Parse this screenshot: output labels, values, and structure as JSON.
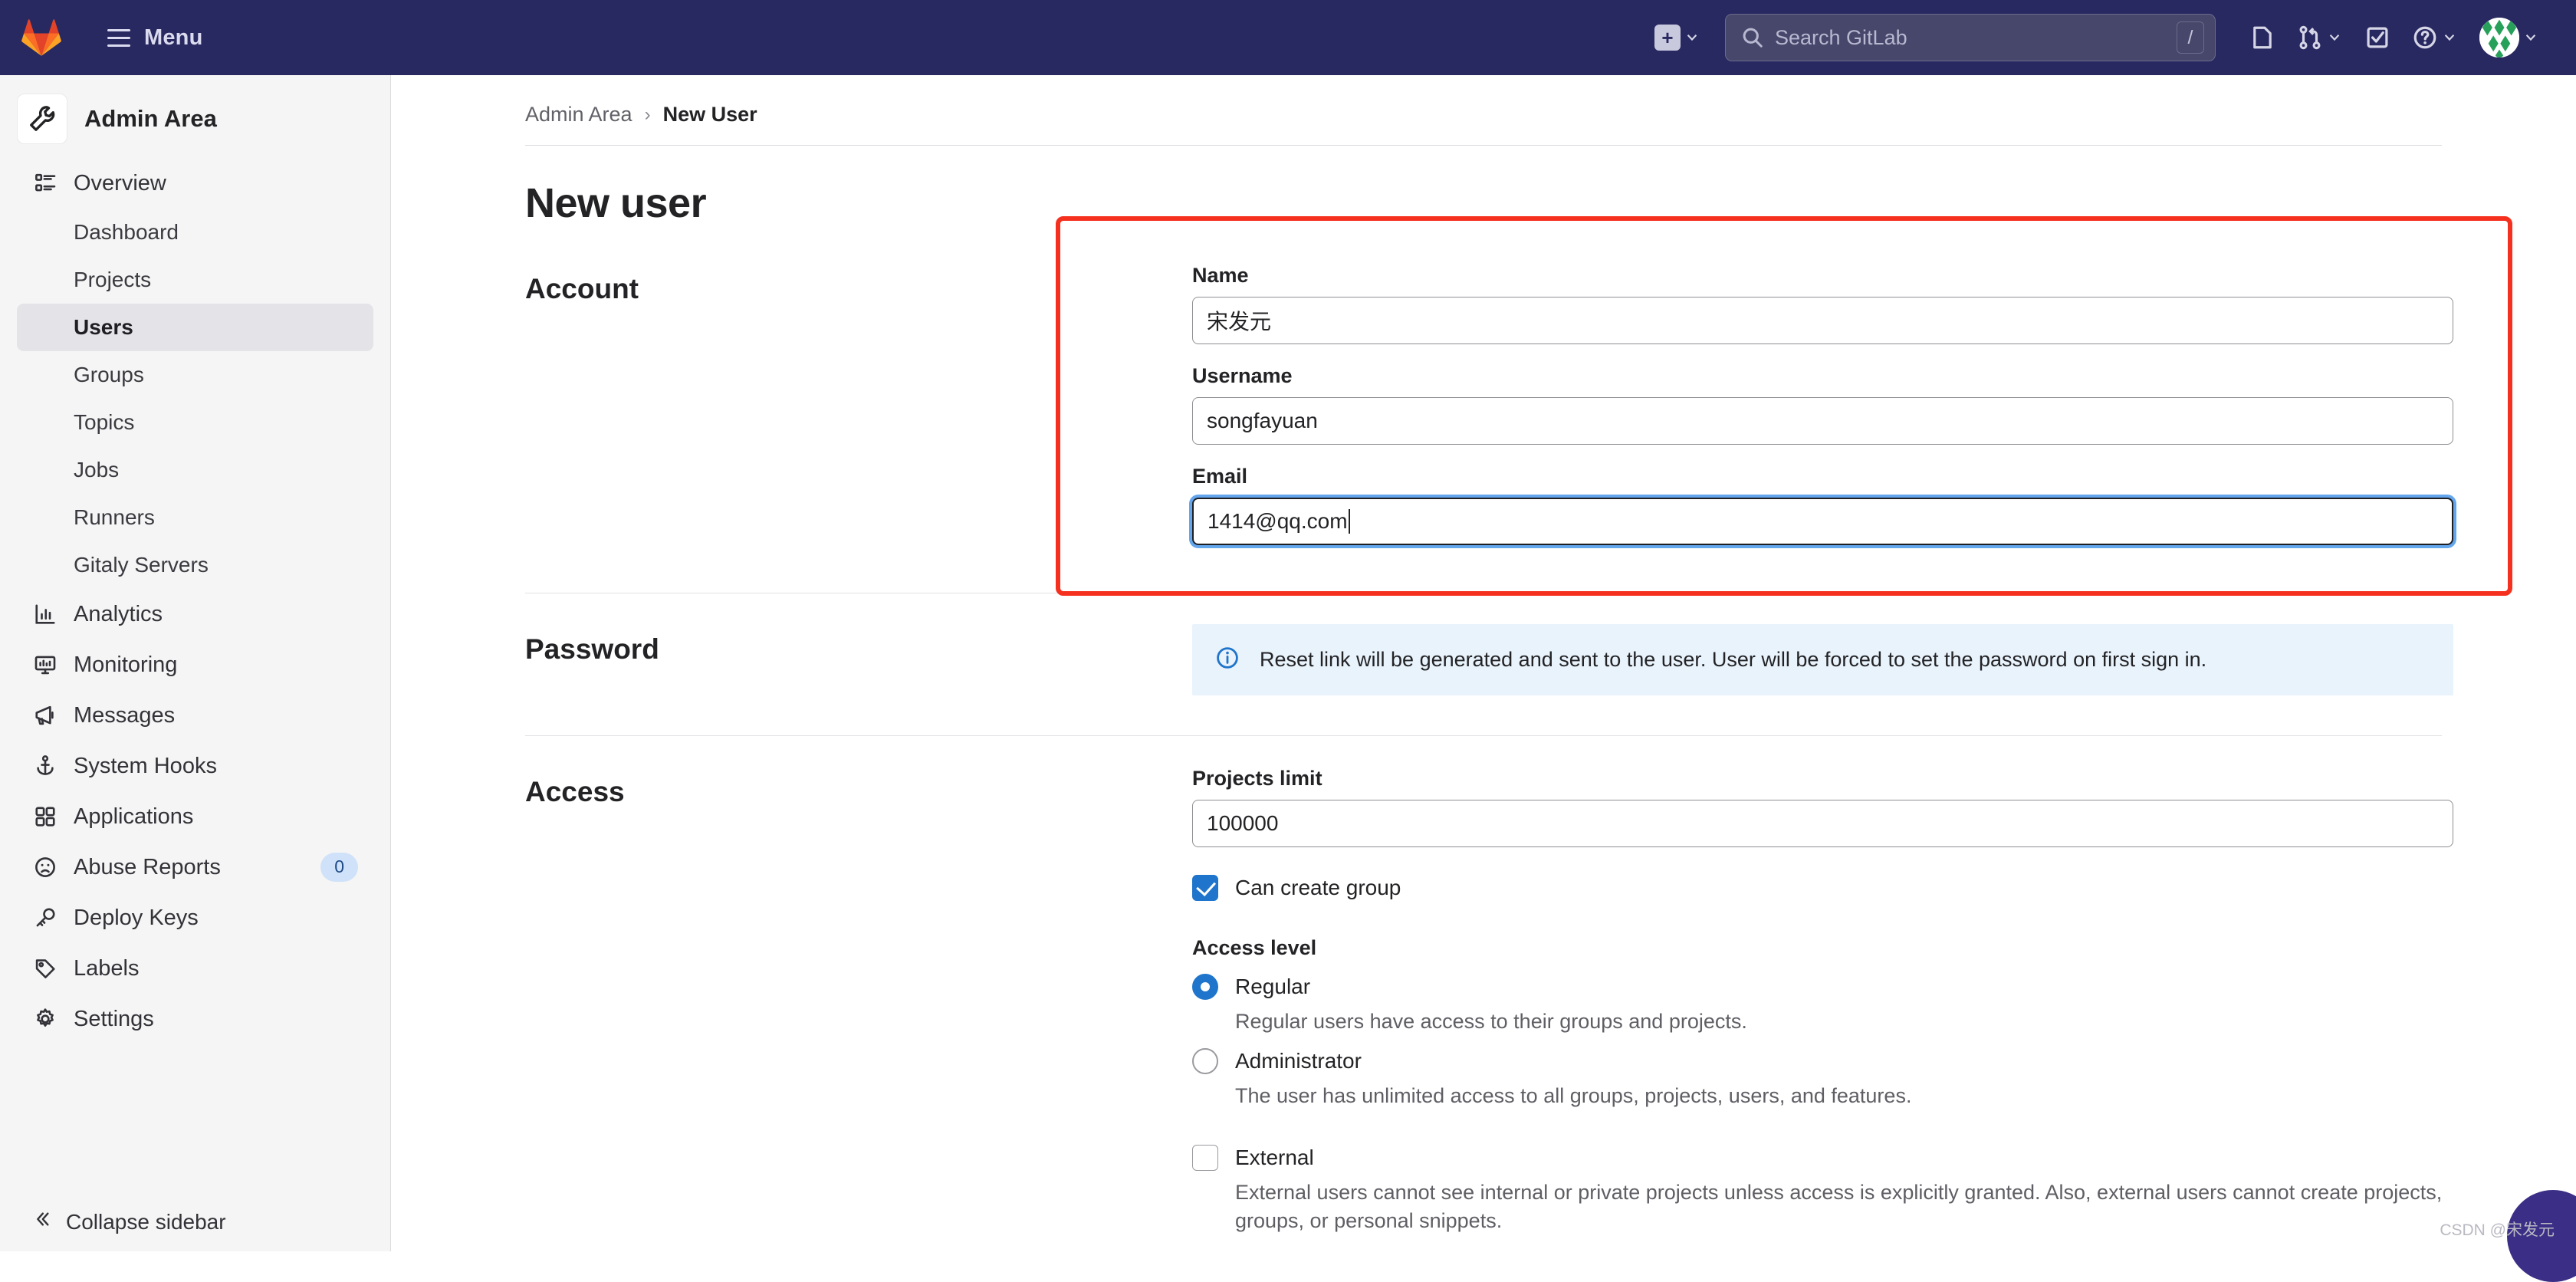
{
  "topbar": {
    "logo_icon": "gitlab-tanuki-icon",
    "menu_label": "Menu",
    "new_icon": "plus-square-icon",
    "search_placeholder": "Search GitLab",
    "search_icon": "search-icon",
    "search_shortcut": "/",
    "issues_icon": "issues-icon",
    "merge_requests_icon": "merge-request-icon",
    "todos_icon": "todo-done-icon",
    "help_icon": "question-circle-icon",
    "avatar_icon": "user-avatar"
  },
  "sidebar": {
    "context_title": "Admin Area",
    "context_icon": "wrench-icon",
    "collapse_label": "Collapse sidebar",
    "collapse_icon": "chevron-double-left-icon",
    "items": [
      {
        "label": "Overview",
        "icon": "overview-list-icon",
        "level": "top",
        "active": false
      },
      {
        "label": "Dashboard",
        "icon": "",
        "level": "sub",
        "active": false
      },
      {
        "label": "Projects",
        "icon": "",
        "level": "sub",
        "active": false
      },
      {
        "label": "Users",
        "icon": "",
        "level": "sub",
        "active": true
      },
      {
        "label": "Groups",
        "icon": "",
        "level": "sub",
        "active": false
      },
      {
        "label": "Topics",
        "icon": "",
        "level": "sub",
        "active": false
      },
      {
        "label": "Jobs",
        "icon": "",
        "level": "sub",
        "active": false
      },
      {
        "label": "Runners",
        "icon": "",
        "level": "sub",
        "active": false
      },
      {
        "label": "Gitaly Servers",
        "icon": "",
        "level": "sub",
        "active": false
      },
      {
        "label": "Analytics",
        "icon": "chart-bar-icon",
        "level": "top",
        "active": false
      },
      {
        "label": "Monitoring",
        "icon": "monitor-icon",
        "level": "top",
        "active": false
      },
      {
        "label": "Messages",
        "icon": "megaphone-icon",
        "level": "top",
        "active": false
      },
      {
        "label": "System Hooks",
        "icon": "hook-anchor-icon",
        "level": "top",
        "active": false
      },
      {
        "label": "Applications",
        "icon": "applications-icon",
        "level": "top",
        "active": false
      },
      {
        "label": "Abuse Reports",
        "icon": "sad-face-icon",
        "level": "top",
        "active": false,
        "badge": "0"
      },
      {
        "label": "Deploy Keys",
        "icon": "key-icon",
        "level": "top",
        "active": false
      },
      {
        "label": "Labels",
        "icon": "label-tag-icon",
        "level": "top",
        "active": false
      },
      {
        "label": "Settings",
        "icon": "gear-icon",
        "level": "top",
        "active": false
      }
    ]
  },
  "breadcrumb": {
    "parent": "Admin Area",
    "separator": "›",
    "current": "New User"
  },
  "page": {
    "title": "New user"
  },
  "account": {
    "section_label": "Account",
    "name_label": "Name",
    "name_value": "宋发元",
    "username_label": "Username",
    "username_value": "songfayuan",
    "email_label": "Email",
    "email_value": "1414@qq.com"
  },
  "password": {
    "section_label": "Password",
    "info_icon": "info-circle-icon",
    "info_text": "Reset link will be generated and sent to the user. User will be forced to set the password on first sign in."
  },
  "access": {
    "section_label": "Access",
    "projects_limit_label": "Projects limit",
    "projects_limit_value": "100000",
    "can_create_group_label": "Can create group",
    "can_create_group_checked": true,
    "access_level_label": "Access level",
    "levels": [
      {
        "label": "Regular",
        "selected": true,
        "help": "Regular users have access to their groups and projects."
      },
      {
        "label": "Administrator",
        "selected": false,
        "help": "The user has unlimited access to all groups, projects, users, and features."
      }
    ],
    "external_label": "External",
    "external_checked": false,
    "external_help": "External users cannot see internal or private projects unless access is explicitly granted. Also, external users cannot create projects, groups, or personal snippets."
  },
  "annotation": {
    "highlight_color": "#f5301e"
  },
  "watermark": {
    "text": "CSDN @宋发元"
  }
}
